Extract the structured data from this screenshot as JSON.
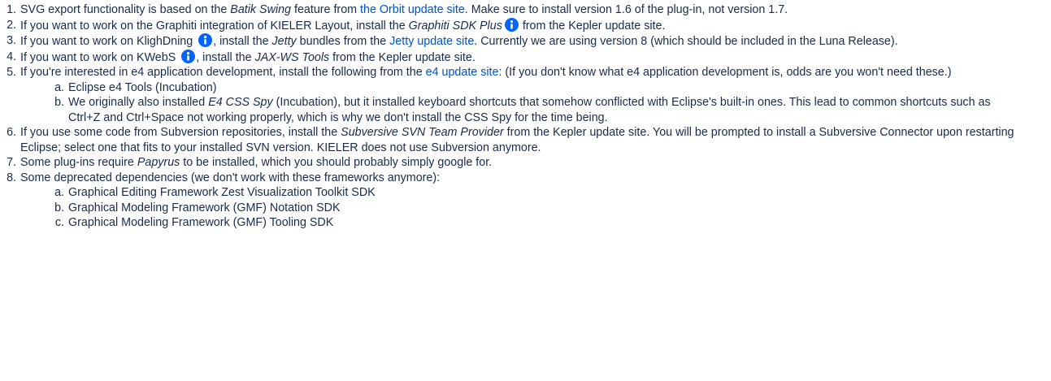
{
  "colors": {
    "text": "#172b4d",
    "link": "#0052cc",
    "info_icon": "#0065ff"
  },
  "icons": {
    "info": "info-icon"
  },
  "items": [
    {
      "num": "1.",
      "p1": "SVG export functionality is based on the ",
      "em1": "Batik Swing",
      "p2": " feature  from ",
      "link1": "the Orbit update site",
      "p3": ". Make sure to install version 1.6 of the plug-in, not version 1.7."
    },
    {
      "num": "2.",
      "p1": "If you want to work on the Graphiti integration of KIELER Layout, install the ",
      "em1": "Graphiti SDK Plus",
      "p2": " from the Kepler update site."
    },
    {
      "num": "3.",
      "p1": "If you want to work on KlighDning ",
      "p2": ", install the ",
      "em1": "Jetty",
      "p3": " bundles from the ",
      "link1": "Jetty update site",
      "p4": ". Currently we are using version 8 (which should be included in the Luna Release)."
    },
    {
      "num": "4.",
      "p1": "If you want to work on KWebS ",
      "p2": ", install the ",
      "em1": "JAX-WS Tools",
      "p3": " from the Kepler update site."
    },
    {
      "num": "5.",
      "p1": "If you're interested in e4 application development, install the following from the ",
      "link1": "e4 update site",
      "p2": ": (If you don't know what e4 application development is, odds are you won't need these.)",
      "sub": [
        {
          "num": "a.",
          "text": "Eclipse e4 Tools (Incubation)"
        },
        {
          "num": "b.",
          "p1": "We originally also installed ",
          "em1": "E4 CSS Spy",
          "p2": " (Incubation), but it installed keyboard shortcuts that somehow conflicted with Eclipse's built-in ones. This lead to common shortcuts such as Ctrl+Z and Ctrl+Space not working properly, which is why we don't install the CSS Spy for the time being."
        }
      ]
    },
    {
      "num": "6.",
      "p1": "If you use some code from Subversion repositories, install the ",
      "em1": "Subversive SVN Team Provider",
      "p2": " from the Kepler update site. You will be prompted to install a Subversive Connector upon restarting Eclipse; select one that fits to your installed SVN version. KIELER does not use Subversion anymore."
    },
    {
      "num": "7.",
      "p1": "Some plug-ins require ",
      "em1": "Papyrus",
      "p2": " to be installed, which you should probably simply google for."
    },
    {
      "num": "8.",
      "p1": "Some deprecated dependencies (we don't work with these frameworks anymore):",
      "sub": [
        {
          "num": "a.",
          "text": "Graphical Editing Framework Zest Visualization Toolkit SDK"
        },
        {
          "num": "b.",
          "text": "Graphical Modeling Framework (GMF) Notation SDK"
        },
        {
          "num": "c.",
          "text": "Graphical Modeling Framework (GMF) Tooling SDK"
        }
      ]
    }
  ]
}
